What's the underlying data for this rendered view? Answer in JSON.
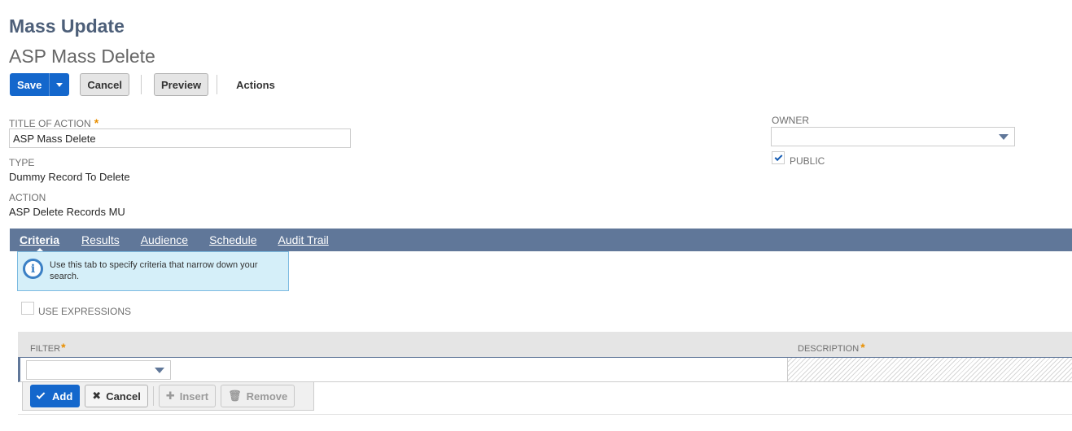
{
  "header": {
    "page_heading": "Mass Update",
    "record_title": "ASP Mass Delete"
  },
  "toolbar": {
    "save_label": "Save",
    "cancel_label": "Cancel",
    "preview_label": "Preview",
    "actions_label": "Actions"
  },
  "form": {
    "title_label": "TITLE OF ACTION",
    "title_value": "ASP Mass Delete",
    "required_mark": "*",
    "type_label": "TYPE",
    "type_value": "Dummy Record To Delete",
    "action_label": "ACTION",
    "action_value": "ASP Delete Records MU",
    "owner_label": "OWNER",
    "owner_value": "",
    "public_label": "PUBLIC",
    "public_checked": true
  },
  "tabs": [
    {
      "label": "Criteria",
      "active": true
    },
    {
      "label": "Results",
      "active": false
    },
    {
      "label": "Audience",
      "active": false
    },
    {
      "label": "Schedule",
      "active": false
    },
    {
      "label": "Audit Trail",
      "active": false
    }
  ],
  "info": {
    "icon": "info-icon",
    "glyph": "i",
    "text": "Use this tab to specify criteria that narrow down your search."
  },
  "criteria": {
    "use_expressions_label": "USE EXPRESSIONS",
    "use_expressions_checked": false,
    "filter_header": "FILTER",
    "description_header": "DESCRIPTION",
    "filter_value": ""
  },
  "row_actions": {
    "add_label": "Add",
    "cancel_label": "Cancel",
    "insert_label": "Insert",
    "remove_label": "Remove"
  },
  "colors": {
    "brand_blue": "#1467cc",
    "tab_bar": "#607799",
    "heading": "#4d5f79",
    "required": "#e98f00",
    "info_bg": "#d5eff9"
  }
}
